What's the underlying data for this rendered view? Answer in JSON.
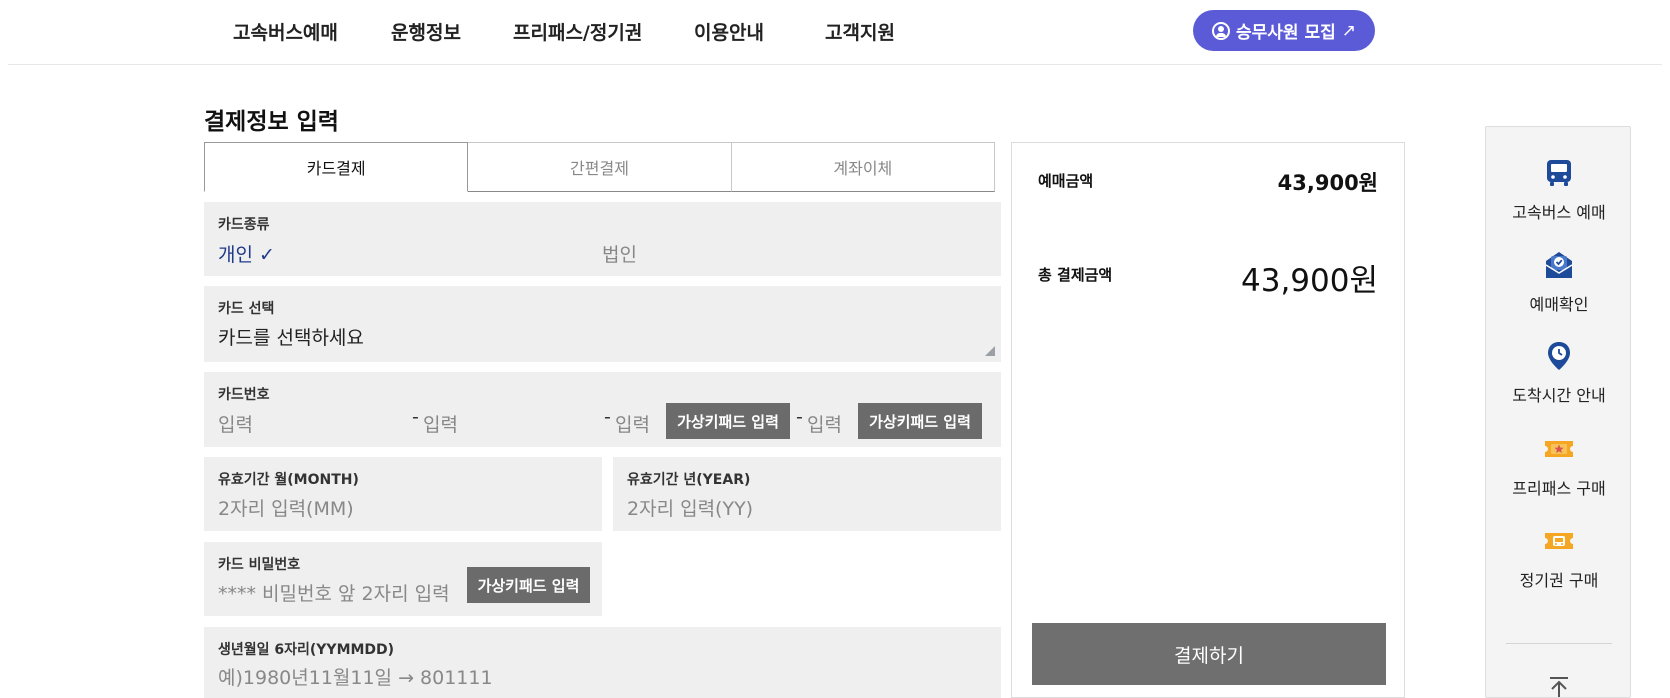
{
  "nav": {
    "items": [
      "고속버스예매",
      "운행정보",
      "프리패스/정기권",
      "이용안내",
      "고객지원"
    ],
    "recruit_label": "승무사원 모집",
    "recruit_arrow": "↗"
  },
  "page_title": "결제정보 입력",
  "tabs": [
    {
      "label": "카드결제",
      "active": true
    },
    {
      "label": "간편결제",
      "active": false
    },
    {
      "label": "계좌이체",
      "active": false
    }
  ],
  "form": {
    "card_type": {
      "label": "카드종류",
      "option_personal": "개인",
      "check": "✓",
      "option_corporate": "법인"
    },
    "card_select": {
      "label": "카드 선택",
      "value": "카드를 선택하세요"
    },
    "card_number": {
      "label": "카드번호",
      "placeholder": "입력",
      "dash": "-",
      "keypad_label": "가상키패드 입력"
    },
    "exp_month": {
      "label": "유효기간 월(MONTH)",
      "placeholder": "2자리 입력(MM)"
    },
    "exp_year": {
      "label": "유효기간 년(YEAR)",
      "placeholder": "2자리 입력(YY)"
    },
    "card_pw": {
      "label": "카드 비밀번호",
      "placeholder": "**** 비밀번호 앞 2자리 입력",
      "keypad_label": "가상키패드 입력"
    },
    "birth": {
      "label": "생년월일 6자리(YYMMDD)",
      "placeholder": "예)1980년11월11일 → 801111"
    }
  },
  "summary": {
    "booking_label": "예매금액",
    "booking_amount": "43,900원",
    "total_label": "총 결제금액",
    "total_amount": "43,900원",
    "pay_label": "결제하기"
  },
  "quick_menu": {
    "items": [
      "고속버스 예매",
      "예매확인",
      "도착시간 안내",
      "프리패스 구매",
      "정기권 구매"
    ]
  },
  "colors": {
    "accent": "#5b5bd8",
    "button_gray": "#6b6b6b",
    "icon_blue": "#1e4a9a",
    "icon_gold": "#f5a623"
  }
}
